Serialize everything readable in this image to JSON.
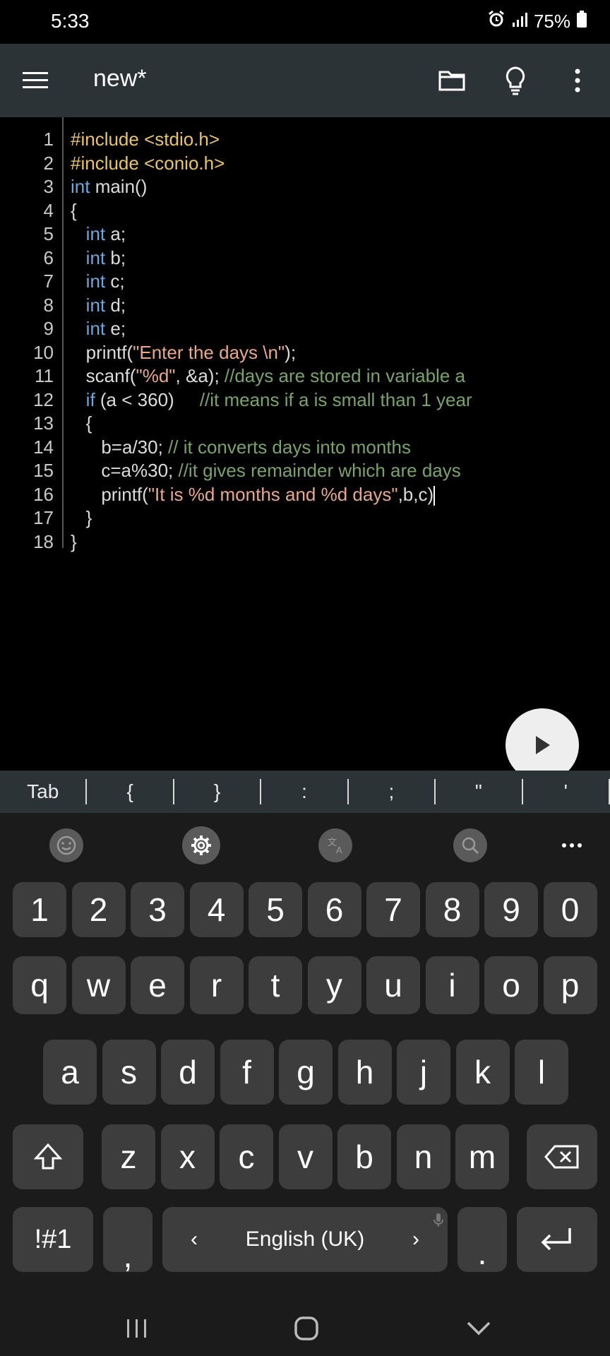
{
  "status": {
    "time": "5:33",
    "battery": "75%"
  },
  "appbar": {
    "title": "new*"
  },
  "editor": {
    "line_numbers": [
      "1",
      "2",
      "3",
      "4",
      "5",
      "6",
      "7",
      "8",
      "9",
      "10",
      "11",
      "12",
      "13",
      "14",
      "15",
      "16",
      "17",
      "18"
    ],
    "lines": [
      [
        {
          "t": "#include <stdio.h>",
          "c": "inc"
        }
      ],
      [
        {
          "t": "#include <conio.h>",
          "c": "inc"
        }
      ],
      [
        {
          "t": "int",
          "c": "kw"
        },
        {
          "t": " main()",
          "c": ""
        }
      ],
      [
        {
          "t": "{",
          "c": ""
        }
      ],
      [
        {
          "t": "   ",
          "c": ""
        },
        {
          "t": "int",
          "c": "kw"
        },
        {
          "t": " a;",
          "c": ""
        }
      ],
      [
        {
          "t": "   ",
          "c": ""
        },
        {
          "t": "int",
          "c": "kw"
        },
        {
          "t": " b;",
          "c": ""
        }
      ],
      [
        {
          "t": "   ",
          "c": ""
        },
        {
          "t": "int",
          "c": "kw"
        },
        {
          "t": " c;",
          "c": ""
        }
      ],
      [
        {
          "t": "   ",
          "c": ""
        },
        {
          "t": "int",
          "c": "kw"
        },
        {
          "t": " d;",
          "c": ""
        }
      ],
      [
        {
          "t": "   ",
          "c": ""
        },
        {
          "t": "int",
          "c": "kw"
        },
        {
          "t": " e;",
          "c": ""
        }
      ],
      [
        {
          "t": "   printf(",
          "c": ""
        },
        {
          "t": "\"Enter the days \\n\"",
          "c": "str"
        },
        {
          "t": ");",
          "c": ""
        }
      ],
      [
        {
          "t": "   scanf(",
          "c": ""
        },
        {
          "t": "\"%d\"",
          "c": "str"
        },
        {
          "t": ", &a); ",
          "c": ""
        },
        {
          "t": "//days are stored in variable a",
          "c": "cmt"
        }
      ],
      [
        {
          "t": "   ",
          "c": ""
        },
        {
          "t": "if",
          "c": "kw"
        },
        {
          "t": " (a < 360)     ",
          "c": ""
        },
        {
          "t": "//it means if a is small than 1 year",
          "c": "cmt"
        }
      ],
      [
        {
          "t": "   {",
          "c": ""
        }
      ],
      [
        {
          "t": "      b=a/30; ",
          "c": ""
        },
        {
          "t": "// it converts days into months",
          "c": "cmt"
        }
      ],
      [
        {
          "t": "      c=a%30; ",
          "c": ""
        },
        {
          "t": "//it gives remainder which are days",
          "c": "cmt"
        }
      ],
      [
        {
          "t": "      printf(",
          "c": ""
        },
        {
          "t": "\"It is %d months and %d days\"",
          "c": "str"
        },
        {
          "t": ",b,c)",
          "c": ""
        }
      ],
      [
        {
          "t": "   }",
          "c": ""
        }
      ],
      [
        {
          "t": "}",
          "c": ""
        }
      ]
    ]
  },
  "symbols": [
    "Tab",
    "{",
    "}",
    ":",
    ";",
    "\"",
    "'"
  ],
  "keyboard": {
    "row_numbers": [
      "1",
      "2",
      "3",
      "4",
      "5",
      "6",
      "7",
      "8",
      "9",
      "0"
    ],
    "row1": [
      "q",
      "w",
      "e",
      "r",
      "t",
      "y",
      "u",
      "i",
      "o",
      "p"
    ],
    "row2": [
      "a",
      "s",
      "d",
      "f",
      "g",
      "h",
      "j",
      "k",
      "l"
    ],
    "row3": [
      "z",
      "x",
      "c",
      "v",
      "b",
      "n",
      "m"
    ],
    "symbols_key": "!#1",
    "comma": ",",
    "space_label": "English (UK)",
    "space_left": "‹",
    "space_right": "›",
    "period": "."
  },
  "colors": {
    "appbar": "#2b3337",
    "keyword": "#6fa8dc",
    "include": "#e9c46a",
    "string": "#e8a88c",
    "comment": "#7aa36a"
  }
}
